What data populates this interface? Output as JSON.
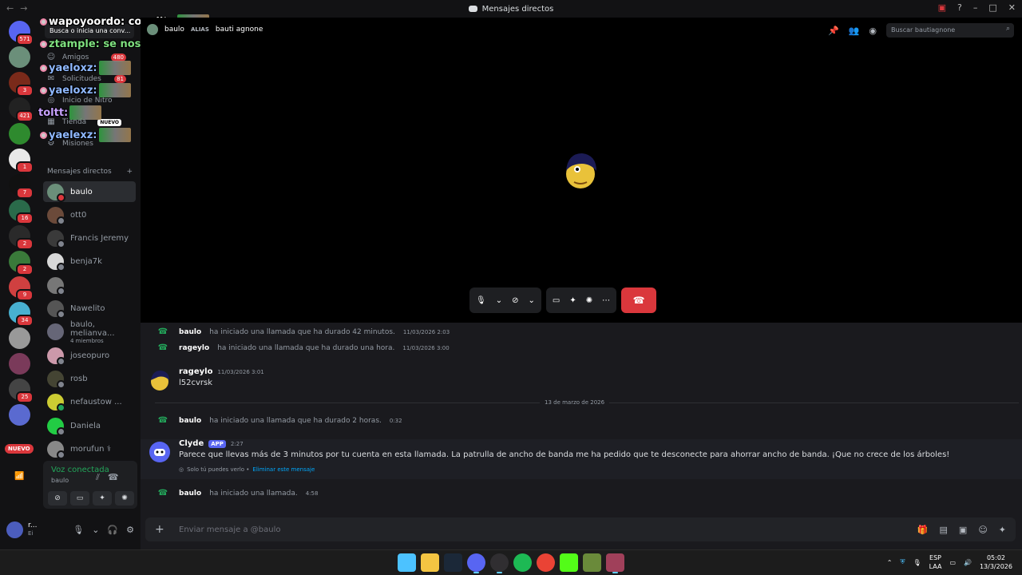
{
  "titlebar": {
    "title": "Mensajes directos"
  },
  "guild_badges": [
    "571",
    "",
    "3",
    "421",
    "",
    "1",
    "7",
    "16",
    "2",
    "2",
    "9",
    "34",
    "",
    "",
    "25",
    ""
  ],
  "guild_nuevo": "NUEVO",
  "sidebar": {
    "search_label": "Busca o inicia una conv...",
    "nav": [
      {
        "label": "Amigos",
        "icon": "friends-icon",
        "badge": "480"
      },
      {
        "label": "Solicitudes",
        "icon": "inbox-icon",
        "badge": "81"
      },
      {
        "label": "Inicio de Nitro",
        "icon": "nitro-icon",
        "badge": ""
      },
      {
        "label": "Tienda",
        "icon": "shop-icon",
        "badge": "NUEVO"
      },
      {
        "label": "Misiones",
        "icon": "quests-icon",
        "badge": ""
      }
    ],
    "dm_header": "Mensajes directos",
    "dms": [
      {
        "name": "baulo",
        "sub": "",
        "status": "dnd",
        "color": "#6b8f7a"
      },
      {
        "name": "ott0",
        "sub": "",
        "status": "offline",
        "color": "#6b4a3a"
      },
      {
        "name": "Francis Jeremy",
        "sub": "",
        "status": "offline",
        "color": "#3a3a3a"
      },
      {
        "name": "benja7k",
        "sub": "",
        "status": "offline",
        "color": "#d8d8d8"
      },
      {
        "name": "",
        "sub": "",
        "status": "offline",
        "color": "#777"
      },
      {
        "name": "Nawelito",
        "sub": "",
        "status": "offline",
        "color": "#555"
      },
      {
        "name": "baulo, melianva...",
        "sub": "4 miembros",
        "status": "none",
        "color": "#667"
      },
      {
        "name": "joseopuro",
        "sub": "",
        "status": "offline",
        "color": "#c9a"
      },
      {
        "name": "rosb",
        "sub": "",
        "status": "offline",
        "color": "#443"
      },
      {
        "name": "nefaustow ...",
        "sub": "",
        "status": "online",
        "color": "#cc3"
      },
      {
        "name": "Daniela",
        "sub": "",
        "status": "offline",
        "color": "#2c4"
      },
      {
        "name": "morufun ⚕",
        "sub": "",
        "status": "offline",
        "color": "#888"
      }
    ],
    "voice": {
      "label": "Voz conectada",
      "who": "baulo"
    },
    "user": {
      "name": "r...",
      "status": "Ei"
    }
  },
  "video": {
    "header_name": "baulo",
    "alias_label": "ALIAS",
    "alias_value": "bauti agnone",
    "search_placeholder": "Buscar bautiagnone"
  },
  "overlay": [
    {
      "text": "wapoyoordo: conejito",
      "color": "#fff"
    },
    {
      "text": "ztample: se nos fue",
      "color": "#7fe07f"
    },
    {
      "text": "yaeloxz:",
      "color": "#8fb8ff"
    },
    {
      "text": "yaeloxz:",
      "color": "#8fb8ff"
    },
    {
      "text": "toltt:",
      "color": "#c9a2ff"
    },
    {
      "text": "yaelexz:",
      "color": "#8fb8ff"
    }
  ],
  "chat": {
    "sys1": {
      "user": "baulo",
      "text": "ha iniciado una llamada que ha durado 42 minutos.",
      "ts": "11/03/2026 2:03"
    },
    "sys2": {
      "user": "rageylo",
      "text": "ha iniciado una llamada que ha durado una hora.",
      "ts": "11/03/2026 3:00"
    },
    "msg1": {
      "user": "rageylo",
      "ts": "11/03/2026 3:01",
      "body": "l52cvrsk"
    },
    "divider": "13 de marzo de 2026",
    "sys3": {
      "user": "baulo",
      "text": "ha iniciado una llamada que ha durado 2 horas.",
      "ts": "0:32"
    },
    "msg2": {
      "user": "Clyde",
      "tag": "APP",
      "ts": "2:27",
      "body": "Parece que llevas más de 3 minutos por tu cuenta en esta llamada. La patrulla de ancho de banda me ha pedido que te desconecte para ahorrar ancho de banda. ¡Que no crece de los árboles!",
      "ephemeral": "Solo tú puedes verlo •",
      "delete": "Eliminar este mensaje"
    },
    "sys4": {
      "user": "baulo",
      "text": "ha iniciado una llamada.",
      "ts": "4:58"
    },
    "composer_placeholder": "Enviar mensaje a @baulo"
  },
  "taskbar": {
    "lang1": "ESP",
    "lang2": "LAA",
    "time": "05:02",
    "date": "13/3/2026"
  },
  "colors": {
    "accent": "#5865f2",
    "danger": "#da373c",
    "online": "#23a55a"
  }
}
